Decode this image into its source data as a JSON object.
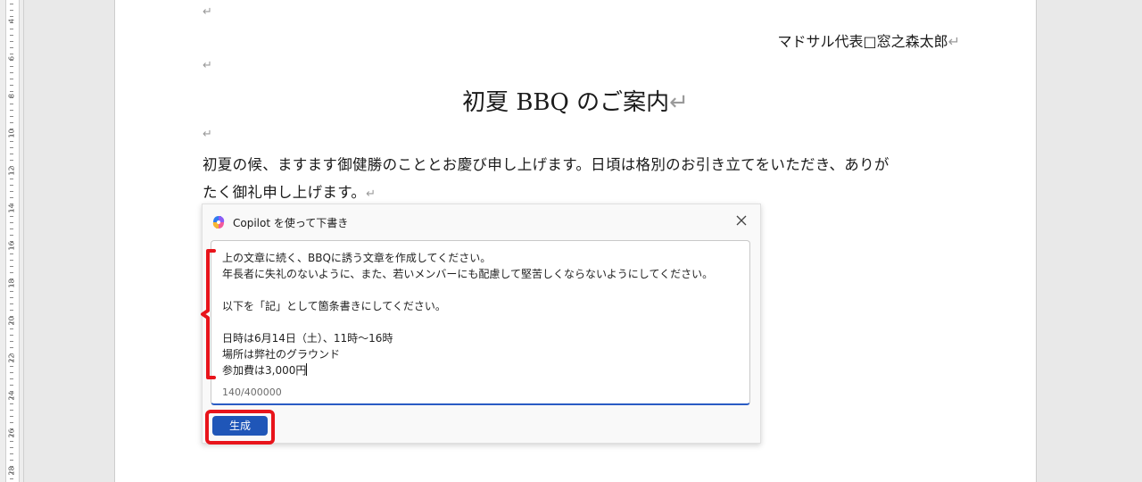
{
  "ruler": {
    "labels": [
      "4",
      "6",
      "8",
      "10",
      "12",
      "14",
      "16",
      "18",
      "20",
      "22",
      "24",
      "26",
      "28"
    ]
  },
  "document": {
    "paragraph_mark": "↵",
    "signature": "マドサル代表□窓之森太郎",
    "title": "初夏 BBQ のご案内",
    "body_line1": "初夏の候、ますます御健勝のこととお慶び申し上げます。日頃は格別のお引き立てをいただき、ありが",
    "body_line2": "たく御礼申し上げます。"
  },
  "copilot": {
    "title": "Copilot を使って下書き",
    "close_icon": "close-icon",
    "prompt_lines": [
      "上の文章に続く、BBQに誘う文章を作成してください。",
      "年長者に失礼のないように、また、若いメンバーにも配慮して堅苦しくならないようにしてください。",
      "",
      "以下を「記」として箇条書きにしてください。",
      "",
      "日時は6月14日（土）、11時～16時",
      "場所は弊社のグラウンド",
      "参加費は3,000円"
    ],
    "char_count": "140/400000",
    "generate_label": "生成",
    "accent_color": "#1f56b8"
  },
  "annotation": {
    "highlight_color": "#e8141b"
  }
}
